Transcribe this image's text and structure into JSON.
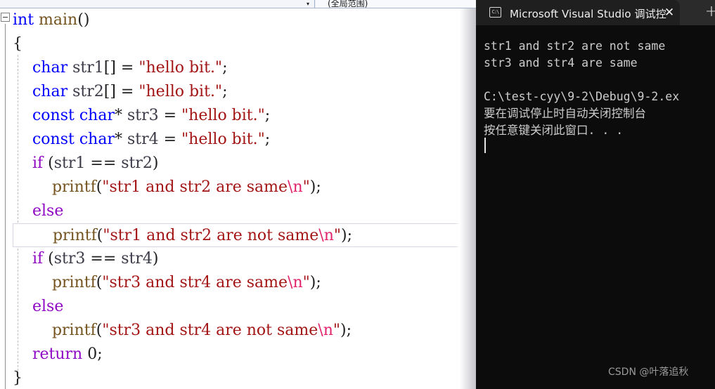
{
  "editor": {
    "navbar": {
      "scope_label": "(全局范围)",
      "chevron_icon": "chevron-down-icon"
    },
    "gutter": {
      "collapse_icon": "collapse-minus-icon"
    },
    "code_lines": [
      {
        "id": "line-int-main",
        "highlighted": false,
        "tokens": [
          {
            "t": "int",
            "c": "tk-kw"
          },
          {
            "t": " ",
            "c": "tk-punc"
          },
          {
            "t": "main",
            "c": "tk-fn"
          },
          {
            "t": "()",
            "c": "tk-punc"
          }
        ]
      },
      {
        "id": "line-open-brace",
        "highlighted": false,
        "tokens": [
          {
            "t": "{",
            "c": "tk-punc"
          }
        ]
      },
      {
        "id": "line-char-str1",
        "highlighted": false,
        "tokens": [
          {
            "t": "    ",
            "c": "tk-punc"
          },
          {
            "t": "char",
            "c": "tk-kw"
          },
          {
            "t": " ",
            "c": "tk-punc"
          },
          {
            "t": "str1",
            "c": "tk-id"
          },
          {
            "t": "[] = ",
            "c": "tk-punc"
          },
          {
            "t": "\"hello bit.\"",
            "c": "tk-str"
          },
          {
            "t": ";",
            "c": "tk-punc"
          }
        ]
      },
      {
        "id": "line-char-str2",
        "highlighted": false,
        "tokens": [
          {
            "t": "    ",
            "c": "tk-punc"
          },
          {
            "t": "char",
            "c": "tk-kw"
          },
          {
            "t": " ",
            "c": "tk-punc"
          },
          {
            "t": "str2",
            "c": "tk-id"
          },
          {
            "t": "[] = ",
            "c": "tk-punc"
          },
          {
            "t": "\"hello bit.\"",
            "c": "tk-str"
          },
          {
            "t": ";",
            "c": "tk-punc"
          }
        ]
      },
      {
        "id": "line-const-str3",
        "highlighted": false,
        "tokens": [
          {
            "t": "    ",
            "c": "tk-punc"
          },
          {
            "t": "const",
            "c": "tk-kw"
          },
          {
            "t": " ",
            "c": "tk-punc"
          },
          {
            "t": "char",
            "c": "tk-kw"
          },
          {
            "t": "* ",
            "c": "tk-punc"
          },
          {
            "t": "str3",
            "c": "tk-id"
          },
          {
            "t": " = ",
            "c": "tk-punc"
          },
          {
            "t": "\"hello bit.\"",
            "c": "tk-str"
          },
          {
            "t": ";",
            "c": "tk-punc"
          }
        ]
      },
      {
        "id": "line-const-str4",
        "highlighted": false,
        "tokens": [
          {
            "t": "    ",
            "c": "tk-punc"
          },
          {
            "t": "const",
            "c": "tk-kw"
          },
          {
            "t": " ",
            "c": "tk-punc"
          },
          {
            "t": "char",
            "c": "tk-kw"
          },
          {
            "t": "* ",
            "c": "tk-punc"
          },
          {
            "t": "str4",
            "c": "tk-id"
          },
          {
            "t": " = ",
            "c": "tk-punc"
          },
          {
            "t": "\"hello bit.\"",
            "c": "tk-str"
          },
          {
            "t": ";",
            "c": "tk-punc"
          }
        ]
      },
      {
        "id": "line-if-str1-str2",
        "highlighted": false,
        "tokens": [
          {
            "t": "    ",
            "c": "tk-punc"
          },
          {
            "t": "if",
            "c": "tk-ctrl"
          },
          {
            "t": " (",
            "c": "tk-punc"
          },
          {
            "t": "str1",
            "c": "tk-id"
          },
          {
            "t": " == ",
            "c": "tk-punc"
          },
          {
            "t": "str2",
            "c": "tk-id"
          },
          {
            "t": ")",
            "c": "tk-punc"
          }
        ]
      },
      {
        "id": "line-printf-str1-same",
        "highlighted": false,
        "tokens": [
          {
            "t": "        ",
            "c": "tk-punc"
          },
          {
            "t": "printf",
            "c": "tk-fn"
          },
          {
            "t": "(",
            "c": "tk-punc"
          },
          {
            "t": "\"str1 and str2 are same",
            "c": "tk-str"
          },
          {
            "t": "\\n",
            "c": "tk-esc"
          },
          {
            "t": "\"",
            "c": "tk-str"
          },
          {
            "t": ");",
            "c": "tk-punc"
          }
        ]
      },
      {
        "id": "line-else-1",
        "highlighted": false,
        "tokens": [
          {
            "t": "    ",
            "c": "tk-punc"
          },
          {
            "t": "else",
            "c": "tk-ctrl"
          }
        ]
      },
      {
        "id": "line-printf-str1-not-same",
        "highlighted": true,
        "tokens": [
          {
            "t": "        ",
            "c": "tk-punc"
          },
          {
            "t": "printf",
            "c": "tk-fn"
          },
          {
            "t": "(",
            "c": "tk-punc"
          },
          {
            "t": "\"str1 and str2 are not same",
            "c": "tk-str"
          },
          {
            "t": "\\n",
            "c": "tk-esc"
          },
          {
            "t": "\"",
            "c": "tk-str"
          },
          {
            "t": ");",
            "c": "tk-punc"
          }
        ]
      },
      {
        "id": "line-if-str3-str4",
        "highlighted": false,
        "tokens": [
          {
            "t": "    ",
            "c": "tk-punc"
          },
          {
            "t": "if",
            "c": "tk-ctrl"
          },
          {
            "t": " (",
            "c": "tk-punc"
          },
          {
            "t": "str3",
            "c": "tk-id"
          },
          {
            "t": " == ",
            "c": "tk-punc"
          },
          {
            "t": "str4",
            "c": "tk-id"
          },
          {
            "t": ")",
            "c": "tk-punc"
          }
        ]
      },
      {
        "id": "line-printf-str3-same",
        "highlighted": false,
        "tokens": [
          {
            "t": "        ",
            "c": "tk-punc"
          },
          {
            "t": "printf",
            "c": "tk-fn"
          },
          {
            "t": "(",
            "c": "tk-punc"
          },
          {
            "t": "\"str3 and str4 are same",
            "c": "tk-str"
          },
          {
            "t": "\\n",
            "c": "tk-esc"
          },
          {
            "t": "\"",
            "c": "tk-str"
          },
          {
            "t": ");",
            "c": "tk-punc"
          }
        ]
      },
      {
        "id": "line-else-2",
        "highlighted": false,
        "tokens": [
          {
            "t": "    ",
            "c": "tk-punc"
          },
          {
            "t": "else",
            "c": "tk-ctrl"
          }
        ]
      },
      {
        "id": "line-printf-str3-not-same",
        "highlighted": false,
        "tokens": [
          {
            "t": "        ",
            "c": "tk-punc"
          },
          {
            "t": "printf",
            "c": "tk-fn"
          },
          {
            "t": "(",
            "c": "tk-punc"
          },
          {
            "t": "\"str3 and str4 are not same",
            "c": "tk-str"
          },
          {
            "t": "\\n",
            "c": "tk-esc"
          },
          {
            "t": "\"",
            "c": "tk-str"
          },
          {
            "t": ");",
            "c": "tk-punc"
          }
        ]
      },
      {
        "id": "line-return-0",
        "highlighted": false,
        "tokens": [
          {
            "t": "    ",
            "c": "tk-punc"
          },
          {
            "t": "return",
            "c": "tk-ctrl"
          },
          {
            "t": " ",
            "c": "tk-punc"
          },
          {
            "t": "0",
            "c": "tk-num"
          },
          {
            "t": ";",
            "c": "tk-punc"
          }
        ]
      },
      {
        "id": "line-close-brace",
        "highlighted": false,
        "tokens": [
          {
            "t": "}",
            "c": "tk-punc"
          }
        ]
      }
    ]
  },
  "console": {
    "titlebar": {
      "icon_glyph": "C:\\",
      "icon_name": "console-app-icon",
      "title": "Microsoft Visual Studio 调试控",
      "close_label": "✕",
      "newtab_label": "+"
    },
    "output_lines": [
      "str1 and str2 are not same",
      "str3 and str4 are same",
      "",
      "C:\\test-cyy\\9-2\\Debug\\9-2.ex",
      "要在调试停止时自动关闭控制台",
      "按任意键关闭此窗口. . ."
    ],
    "watermark": "CSDN @叶落追秋"
  },
  "colors": {
    "keyword_blue": "#0000ff",
    "control_purple": "#8f08c4",
    "function_olive": "#74531f",
    "string_red": "#a31515",
    "escape_pink": "#e2236b",
    "console_bg": "#0c0c0c",
    "titlebar_bg": "#1f1f1f",
    "editor_bg": "#ffffff"
  }
}
